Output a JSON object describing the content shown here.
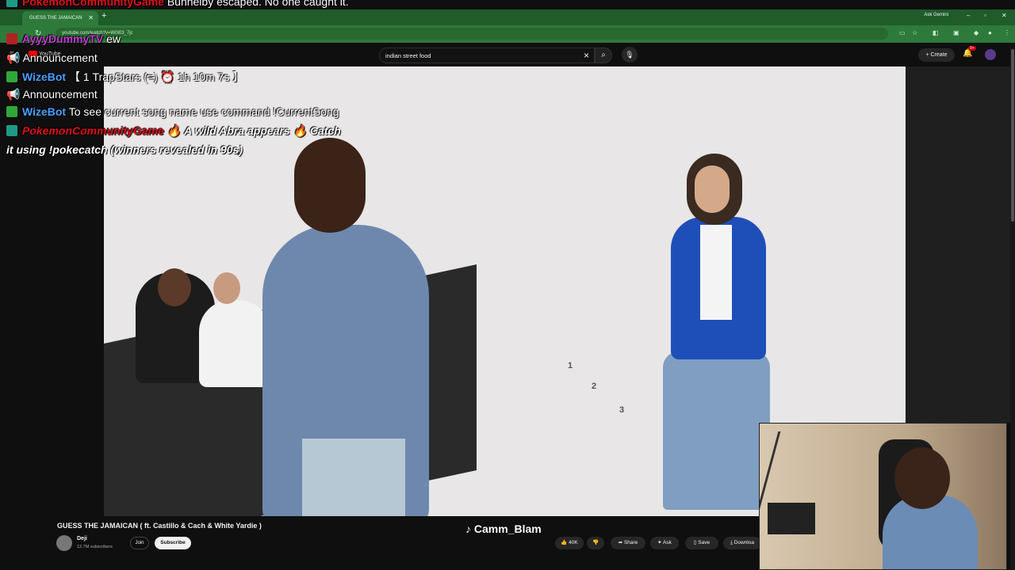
{
  "browser": {
    "tab_title": "GUESS THE JAMAICAN",
    "new_tab": "+",
    "ask_gemini": "Ask Gemini",
    "url": "youtube.com/watch?v=W0l03_7jc"
  },
  "youtube": {
    "logo_text": "YouTube",
    "search_query": "indian street food",
    "create_label": "Create",
    "notification_count": "9+"
  },
  "video": {
    "title": "GUESS THE JAMAICAN ( ft. Castillo & Cach & White Yardie )",
    "channel": "Deji",
    "subscribers": "12.7M subscribers",
    "join_label": "Join",
    "subscribe_label": "Subscribe",
    "likes": "40K",
    "share_label": "Share",
    "ask_label": "Ask",
    "save_label": "Save",
    "download_label": "Downloa",
    "floor_numbers": [
      "1",
      "2",
      "3"
    ]
  },
  "overlay": {
    "tiktok_handle": "Camm_Blam"
  },
  "chat": {
    "line0_user": "PokemonCommunityGame",
    "line0_msg": "Bunnelby escaped. No one caught it.",
    "line1_user": "AyyyDummyTV",
    "line1_msg": "ew",
    "line2_msg": "Announcement",
    "line3_user": "WizeBot",
    "line3_msg": "【 1 TrapStars (=) ⏰ 1h 10m 7s 】",
    "line4_msg": "Announcement",
    "line5_user": "WizeBot",
    "line5_msg": "To see current song name use command !CurrentSong",
    "line6_user": "PokemonCommunityGame",
    "line6_msg": "A wild Abra appears",
    "line6_tail": "Catch",
    "line7_msg": "it using !pokecatch (winners revealed in 90s)"
  }
}
